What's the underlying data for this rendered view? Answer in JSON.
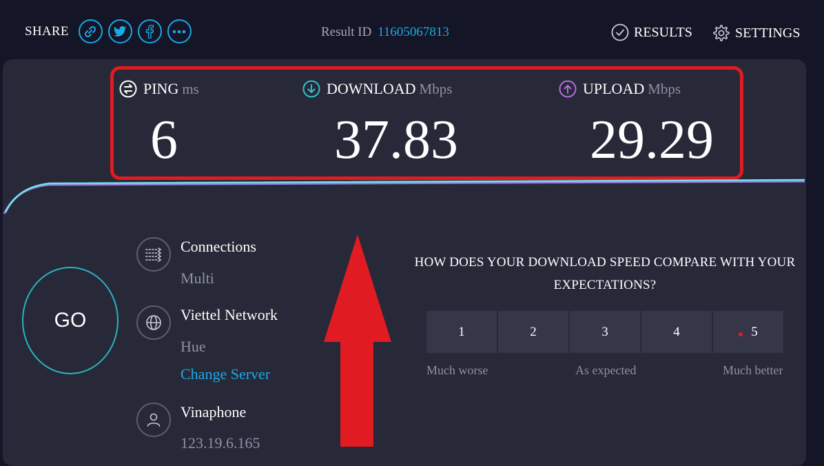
{
  "header": {
    "share_label": "SHARE",
    "share_buttons": [
      "link-icon",
      "twitter-icon",
      "facebook-icon",
      "more-icon"
    ],
    "result_id_label": "Result ID",
    "result_id": "11605067813",
    "results_label": "RESULTS",
    "settings_label": "SETTINGS"
  },
  "metrics": {
    "ping": {
      "label": "PING",
      "unit": "ms",
      "value": "6"
    },
    "download": {
      "label": "DOWNLOAD",
      "unit": "Mbps",
      "value": "37.83"
    },
    "upload": {
      "label": "UPLOAD",
      "unit": "Mbps",
      "value": "29.29"
    }
  },
  "go_label": "GO",
  "info": {
    "connections": {
      "title": "Connections",
      "sub": "Multi"
    },
    "server": {
      "title": "Viettel Network",
      "sub": "Hue",
      "change": "Change Server"
    },
    "isp": {
      "title": "Vinaphone",
      "sub": "123.19.6.165"
    }
  },
  "survey": {
    "question": "HOW DOES YOUR DOWNLOAD SPEED COMPARE WITH YOUR EXPECTATIONS?",
    "options": [
      "1",
      "2",
      "3",
      "4",
      "5"
    ],
    "labels": {
      "low": "Much worse",
      "mid": "As expected",
      "high": "Much better"
    }
  },
  "colors": {
    "background": "#141526",
    "panel": "#272938",
    "accent_blue": "#1ba9e8",
    "download_teal": "#2ec4c4",
    "upload_purple": "#b36ee0",
    "annotation_red": "#e11b22"
  }
}
